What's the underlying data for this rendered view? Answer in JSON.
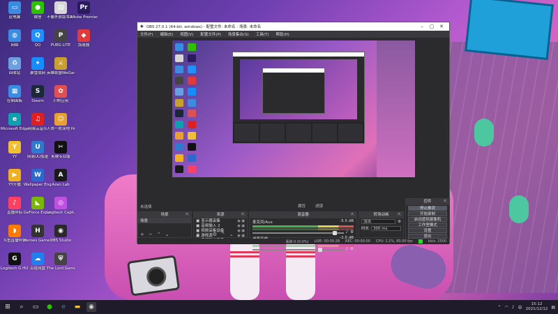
{
  "desktop_icons": [
    {
      "label": "此电脑",
      "col": 0,
      "row": 0,
      "color": "#3b8be0",
      "glyph": "▭"
    },
    {
      "label": "微信",
      "col": 1,
      "row": 0,
      "color": "#2dc100",
      "glyph": "●"
    },
    {
      "label": "不要外放版本2023…",
      "col": 2,
      "row": 0,
      "color": "#d6d6d6",
      "glyph": "▤"
    },
    {
      "label": "Adobe Premiere…",
      "col": 3,
      "row": 0,
      "color": "#2a1a5e",
      "glyph": "Pr"
    },
    {
      "label": "网络",
      "col": 0,
      "row": 1,
      "color": "#3b8be0",
      "glyph": "◍"
    },
    {
      "label": "QQ",
      "col": 1,
      "row": 1,
      "color": "#1e90ff",
      "glyph": "Q"
    },
    {
      "label": "PUBG LITE",
      "col": 2,
      "row": 1,
      "color": "#444444",
      "glyph": "P"
    },
    {
      "label": "加速器",
      "col": 3,
      "row": 1,
      "color": "#e03a3a",
      "glyph": "◆"
    },
    {
      "label": "回收站",
      "col": 0,
      "row": 2,
      "color": "#6aa0e0",
      "glyph": "♻"
    },
    {
      "label": "暴雪战网",
      "col": 1,
      "row": 2,
      "color": "#148eff",
      "glyph": "✦"
    },
    {
      "label": "英雄联盟WeGame版",
      "col": 2,
      "row": 2,
      "color": "#c8a030",
      "glyph": "⚔"
    },
    {
      "label": "控制面板",
      "col": 0,
      "row": 3,
      "color": "#3b8be0",
      "glyph": "▦"
    },
    {
      "label": "Steam",
      "col": 1,
      "row": 3,
      "color": "#1b2838",
      "glyph": "S"
    },
    {
      "label": "小熊应用",
      "col": 2,
      "row": 3,
      "color": "#e05050",
      "glyph": "✿"
    },
    {
      "label": "Microsoft Edge",
      "col": 0,
      "row": 4,
      "color": "#0fa0b0",
      "glyph": "e"
    },
    {
      "label": "网易云音乐",
      "col": 1,
      "row": 4,
      "color": "#e02020",
      "glyph": "♫"
    },
    {
      "label": "人类一败涂地 Human Fa…",
      "col": 2,
      "row": 4,
      "color": "#e8a030",
      "glyph": "☺"
    },
    {
      "label": "YY",
      "col": 0,
      "row": 5,
      "color": "#f0c030",
      "glyph": "Y"
    },
    {
      "label": "网易UU加速",
      "col": 1,
      "row": 5,
      "color": "#2e7ad0",
      "glyph": "U"
    },
    {
      "label": "剪映专业版",
      "col": 2,
      "row": 5,
      "color": "#111111",
      "glyph": "✂"
    },
    {
      "label": "YY开播",
      "col": 0,
      "row": 6,
      "color": "#f0b020",
      "glyph": "▶"
    },
    {
      "label": "Wallpaper Engine",
      "col": 1,
      "row": 6,
      "color": "#2a6ad0",
      "glyph": "W"
    },
    {
      "label": "Azan Lab",
      "col": 2,
      "row": 6,
      "color": "#1a1a1a",
      "glyph": "A"
    },
    {
      "label": "直播伴侣",
      "col": 0,
      "row": 7,
      "color": "#ff4060",
      "glyph": "♪"
    },
    {
      "label": "GeForce Experience",
      "col": 1,
      "row": 7,
      "color": "#76b900",
      "glyph": "◣"
    },
    {
      "label": "Logitech Capture",
      "col": 2,
      "row": 7,
      "color": "#c050e0",
      "glyph": "◎"
    },
    {
      "label": "斗鱼直播伴侣",
      "col": 0,
      "row": 8,
      "color": "#ff7a00",
      "glyph": "◗"
    },
    {
      "label": "Heroes Game Center",
      "col": 1,
      "row": 8,
      "color": "#333333",
      "glyph": "H"
    },
    {
      "label": "OBS Studio",
      "col": 2,
      "row": 8,
      "color": "#2a2a2a",
      "glyph": "◉"
    },
    {
      "label": "Logitech G HUB",
      "col": 0,
      "row": 9,
      "color": "#111111",
      "glyph": "G"
    },
    {
      "label": "百度网盘",
      "col": 1,
      "row": 9,
      "color": "#2080f0",
      "glyph": "☁"
    },
    {
      "label": "The Lord Game",
      "col": 2,
      "row": 9,
      "color": "#444444",
      "glyph": "⛨"
    }
  ],
  "obs": {
    "title": "OBS 27.0.1 (64-bit, windows) - 配置文件: 未命名 - 场景: 未命名",
    "menus": [
      "文件(F)",
      "编辑(E)",
      "视图(V)",
      "配置文件(P)",
      "场景集合(S)",
      "工具(T)",
      "帮助(H)"
    ],
    "source_bar": {
      "left": "未选择",
      "props": "属性",
      "filters": "滤镜"
    },
    "scenes_title": "场景",
    "scenes": [
      "场景"
    ],
    "sources_title": "来源",
    "sources": [
      "显示器采集",
      "音频输入 2",
      "视频采集设备",
      "游戏源",
      "音频输出采集"
    ],
    "mixer_title": "混音器",
    "tracks": [
      {
        "name": "麦克风/Aux",
        "db": "-5.5 dB"
      },
      {
        "name": "桌面音频",
        "db": "-1.5 dB"
      }
    ],
    "trans_title": "转场动画",
    "trans_type": "淡出",
    "duration_label": "时长",
    "duration_value": "300 ms",
    "ctrls_title": "控件",
    "controls": [
      "停止推流",
      "开始录制",
      "启动虚拟摄像机",
      "工作室模式",
      "设置",
      "退出"
    ],
    "status": [
      "丢帧 0 (0.0%)",
      "LIVE: 00:00:28",
      "REC: 00:00:00",
      "CPU: 1.1%, 60.00 fps",
      "kb/s: 2500"
    ]
  },
  "taskbar": {
    "icons": [
      "windows-icon",
      "search-icon",
      "task-view-icon",
      "wechat-icon",
      "edge-icon",
      "explorer-icon",
      "obs-icon"
    ],
    "tray_time": "15:12",
    "tray_date": "2021/12/12",
    "tray_lang": "中"
  }
}
